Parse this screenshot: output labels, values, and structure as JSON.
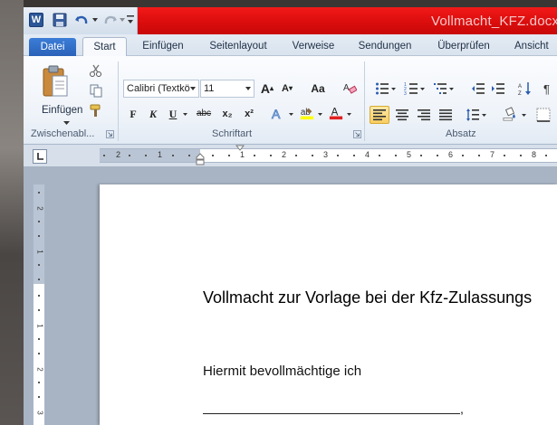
{
  "window": {
    "title": "Vollmacht_KFZ.docx  -  Microsoft Word"
  },
  "quick_access": {
    "app_icon_letter": "W"
  },
  "tabs": [
    {
      "label": "Datei"
    },
    {
      "label": "Start"
    },
    {
      "label": "Einfügen"
    },
    {
      "label": "Seitenlayout"
    },
    {
      "label": "Verweise"
    },
    {
      "label": "Sendungen"
    },
    {
      "label": "Überprüfen"
    },
    {
      "label": "Ansicht"
    }
  ],
  "ribbon": {
    "clipboard": {
      "label": "Zwischenabl...",
      "paste_label": "Einfügen"
    },
    "font": {
      "label": "Schriftart",
      "font_name": "Calibri (Textkö",
      "font_size": "11",
      "bold": "F",
      "italic": "K",
      "underline": "U",
      "strikethrough": "abc",
      "subscript": "x₂",
      "superscript": "x²",
      "grow": "A",
      "shrink": "A",
      "change_case": "Aa"
    },
    "paragraph": {
      "label": "Absatz"
    }
  },
  "ruler": {
    "labels": [
      "2",
      "1",
      "1",
      "1",
      "2",
      "3",
      "4",
      "5",
      "6",
      "7",
      "8"
    ]
  },
  "vruler": {
    "labels": [
      "2",
      "1",
      "1",
      "2",
      "3"
    ]
  },
  "document": {
    "heading": "Vollmacht zur Vorlage bei der Kfz-Zulassungs",
    "body": "Hiermit bevollmächtige ich",
    "line_suffix": ","
  },
  "colors": {
    "title_bar": "#e01010",
    "file_tab": "#2a62b8",
    "ribbon_bg": "#eef3f9",
    "page_bg": "#ffffff"
  }
}
